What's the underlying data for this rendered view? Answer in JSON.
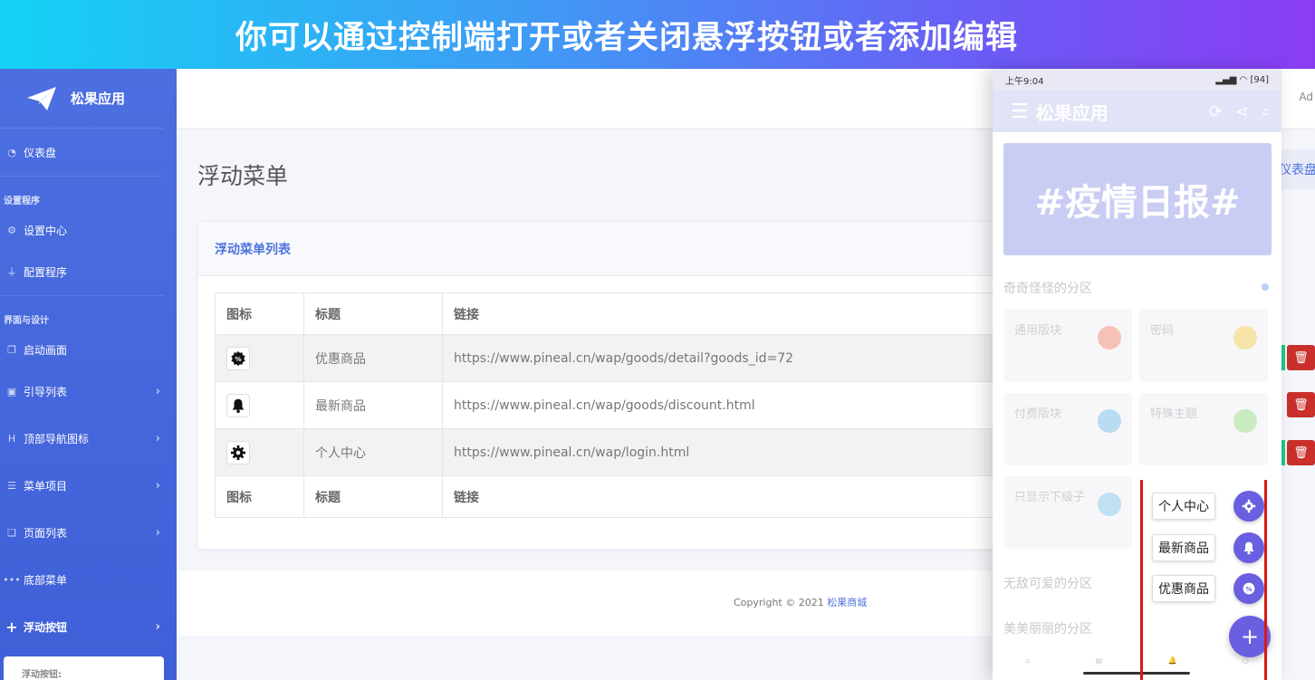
{
  "banner": {
    "text": "你可以通过控制端打开或者关闭悬浮按钮或者添加编辑"
  },
  "sidebar": {
    "brand": "松果应用",
    "dashboard": "仪表盘",
    "section_setup": "设置程序",
    "setting_center": "设置中心",
    "config_program": "配置程序",
    "section_ui": "界面与设计",
    "splash": "启动画面",
    "guide_list": "引导列表",
    "top_nav_icons": "顶部导航图标",
    "menu_items": "菜单项目",
    "page_list": "页面列表",
    "bottom_menu": "底部菜单",
    "float_button": "浮动按钮",
    "sub_panel_label": "浮动按钮:"
  },
  "topbar": {
    "right_text": "Ad"
  },
  "main": {
    "page_title": "浮动菜单",
    "breadcrumb": "仪表盘",
    "card_title": "浮动菜单列表",
    "table": {
      "headers": [
        "图标",
        "标题",
        "链接"
      ],
      "rows": [
        {
          "icon": "percent-badge-icon",
          "title": "优惠商品",
          "link": "https://www.pineal.cn/wap/goods/detail?goods_id=72"
        },
        {
          "icon": "bell-icon",
          "title": "最新商品",
          "link": "https://www.pineal.cn/wap/goods/discount.html"
        },
        {
          "icon": "gear-icon",
          "title": "个人中心",
          "link": "https://www.pineal.cn/wap/login.html"
        }
      ]
    },
    "footer_prefix": "Copyright © 2021",
    "footer_brand": "松果商城"
  },
  "phone": {
    "time": "上午9:04",
    "status_right": "94",
    "app_title": "松果应用",
    "hero_text": "#疫情日报#",
    "section1": "奇奇怪怪的分区",
    "tiles": [
      {
        "title": "通用版块",
        "color": "#f6c2b8"
      },
      {
        "title": "密码",
        "color": "#f6e4a8"
      },
      {
        "title": "付费版块",
        "color": "#b8dcf2"
      },
      {
        "title": "特殊主题",
        "color": "#c8ecc0"
      },
      {
        "title": "只显示下级子",
        "color": "#c0e0f4"
      }
    ],
    "section2": "无敌可爱的分区",
    "section3": "美美丽丽的分区",
    "fab_labels": [
      "个人中心",
      "最新商品",
      "优惠商品"
    ],
    "fab_main": "+"
  },
  "colors": {
    "accent": "#4e73df",
    "fab": "#6a5fe0",
    "danger": "#c9302c",
    "highlight": "#e01515"
  }
}
